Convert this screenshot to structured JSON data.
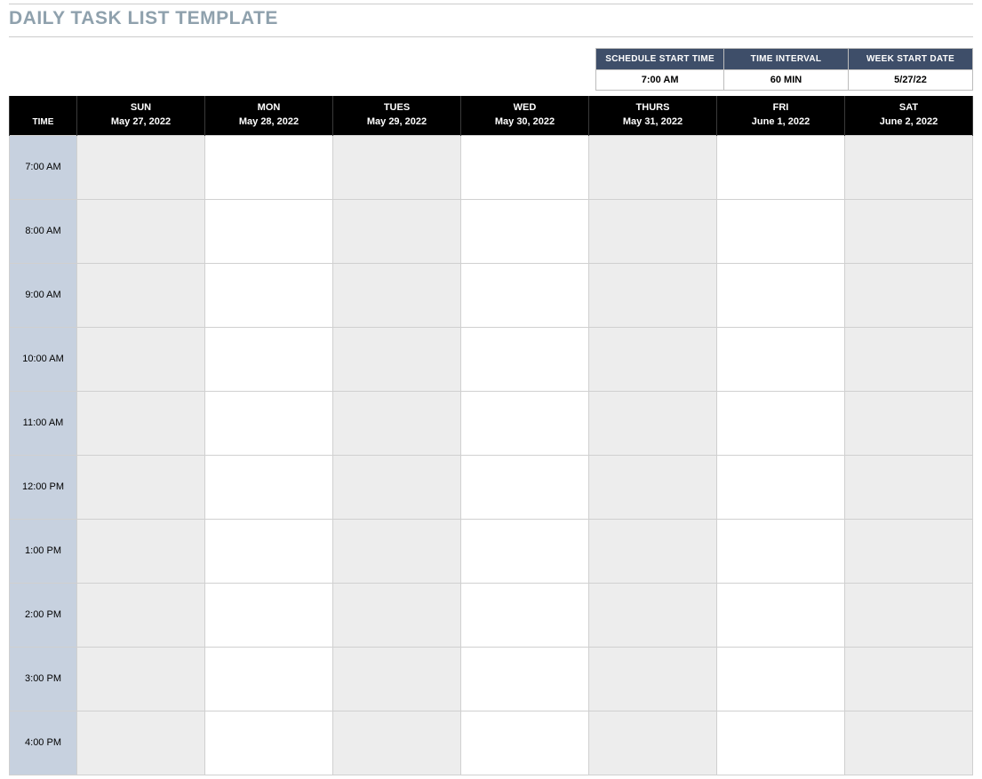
{
  "title": "DAILY TASK LIST TEMPLATE",
  "settings": {
    "headers": {
      "start_time": "SCHEDULE START TIME",
      "interval": "TIME INTERVAL",
      "week_start": "WEEK START DATE"
    },
    "values": {
      "start_time": "7:00 AM",
      "interval": "60 MIN",
      "week_start": "5/27/22"
    }
  },
  "schedule": {
    "time_header": "TIME",
    "days": [
      {
        "name": "SUN",
        "date": "May 27, 2022"
      },
      {
        "name": "MON",
        "date": "May 28, 2022"
      },
      {
        "name": "TUES",
        "date": "May 29, 2022"
      },
      {
        "name": "WED",
        "date": "May 30, 2022"
      },
      {
        "name": "THURS",
        "date": "May 31, 2022"
      },
      {
        "name": "FRI",
        "date": "June 1, 2022"
      },
      {
        "name": "SAT",
        "date": "June 2, 2022"
      }
    ],
    "times": [
      "7:00 AM",
      "8:00 AM",
      "9:00 AM",
      "10:00 AM",
      "11:00 AM",
      "12:00 PM",
      "1:00 PM",
      "2:00 PM",
      "3:00 PM",
      "4:00 PM"
    ],
    "shaded_columns": [
      0,
      2,
      4,
      6
    ]
  }
}
